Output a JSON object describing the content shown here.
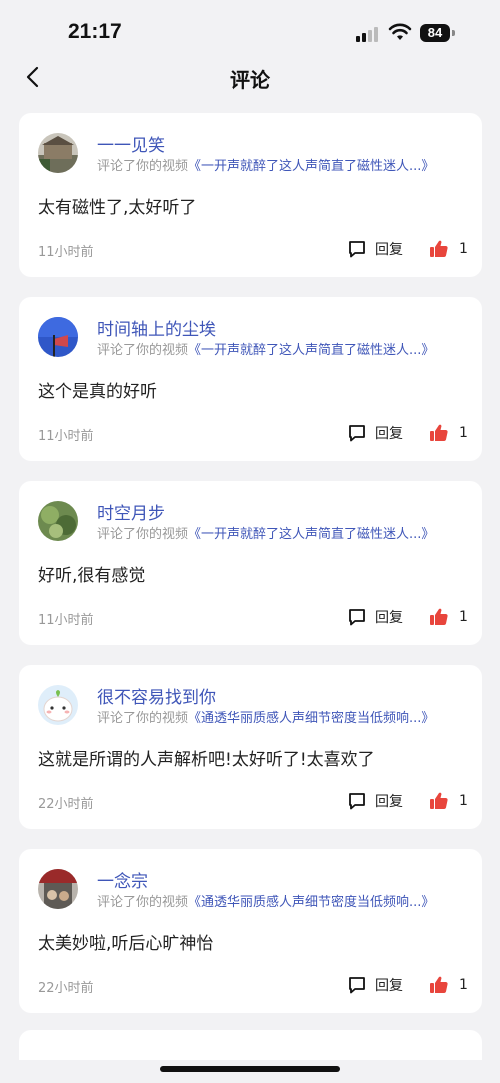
{
  "status": {
    "time": "21:17",
    "battery": "84"
  },
  "nav": {
    "title": "评论"
  },
  "comments": [
    {
      "name": "一一见笑",
      "action": "评论了你的视频",
      "video": "《一开声就醉了这人声简直了磁性迷人...》",
      "text": "太有磁性了,太好听了",
      "time": "11小时前",
      "reply_label": "回复",
      "likes": "1"
    },
    {
      "name": "时间轴上的尘埃",
      "action": "评论了你的视频",
      "video": "《一开声就醉了这人声简直了磁性迷人...》",
      "text": "这个是真的好听",
      "time": "11小时前",
      "reply_label": "回复",
      "likes": "1"
    },
    {
      "name": "时空月步",
      "action": "评论了你的视频",
      "video": "《一开声就醉了这人声简直了磁性迷人...》",
      "text": "好听,很有感觉",
      "time": "11小时前",
      "reply_label": "回复",
      "likes": "1"
    },
    {
      "name": "很不容易找到你",
      "action": "评论了你的视频",
      "video": "《通透华丽质感人声细节密度当低频响...》",
      "text": "这就是所谓的人声解析吧!太好听了!太喜欢了",
      "time": "22小时前",
      "reply_label": "回复",
      "likes": "1"
    },
    {
      "name": "一念宗",
      "action": "评论了你的视频",
      "video": "《通透华丽质感人声细节密度当低频响...》",
      "text": "太美妙啦,听后心旷神怡",
      "time": "22小时前",
      "reply_label": "回复",
      "likes": "1"
    }
  ],
  "colors": {
    "accent": "#3f56b8",
    "like": "#e8453c"
  }
}
